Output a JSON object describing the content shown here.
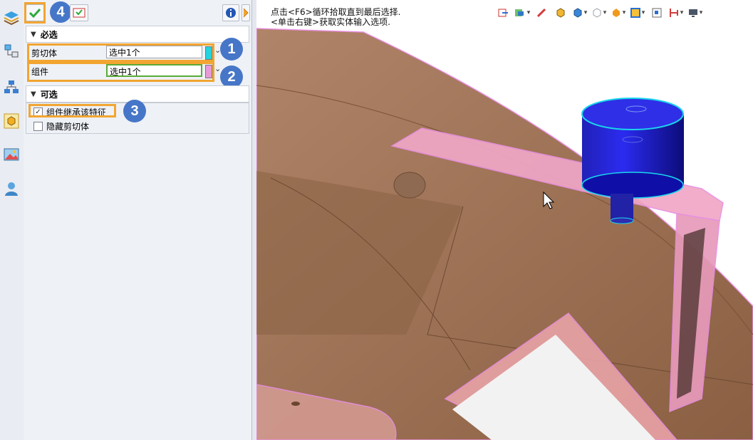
{
  "toolbar": {
    "confirm_badge": "4",
    "info_icon": "info-icon"
  },
  "required_section": {
    "title": "必选",
    "rows": [
      {
        "label": "剪切体",
        "value": "选中1个",
        "swatch_color": "#23d3de",
        "badge": "1"
      },
      {
        "label": "组件",
        "value": "选中1个",
        "swatch_color": "#e79ad8",
        "badge": "2"
      }
    ]
  },
  "optional_section": {
    "title": "可选",
    "options": [
      {
        "label": "组件继承该特征",
        "checked": true,
        "badge": "3"
      },
      {
        "label": "隐藏剪切体",
        "checked": false
      }
    ]
  },
  "viewport": {
    "hint_line1": "点击<F6>循环拾取直到最后选择.",
    "hint_line2": "<单击右键>获取实体输入选项."
  },
  "colors": {
    "accent_callout": "#f2a531",
    "badge_blue": "#4676c7",
    "model_brown": "#9c7558",
    "highlight_pink": "#e88fe0",
    "selected_cylinder": "#1212c9"
  }
}
